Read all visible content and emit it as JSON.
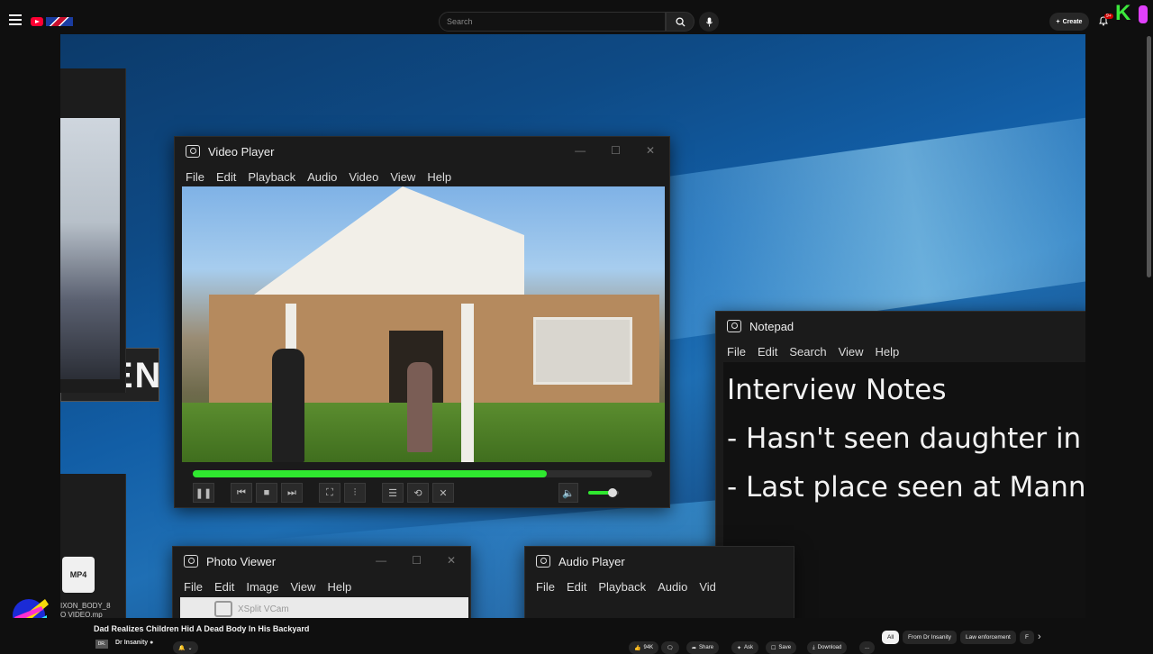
{
  "header": {
    "search_placeholder": "Search",
    "create_label": "Create",
    "notif_badge": "9+",
    "avatar_letter": "K"
  },
  "video_player": {
    "title": "Video Player",
    "menu": [
      "File",
      "Edit",
      "Playback",
      "Audio",
      "Video",
      "View",
      "Help"
    ],
    "progress": 0.77,
    "volume": 0.8
  },
  "left_window": {
    "name_fragment": "LLEN",
    "file_icon": "MP4",
    "file_name_lines": [
      "IXON_BODY_8",
      "O VIDEO.mp"
    ]
  },
  "notepad": {
    "title": "Notepad",
    "menu": [
      "File",
      "Edit",
      "Search",
      "View",
      "Help"
    ],
    "lines": [
      "Interview Notes",
      "- Hasn't seen daughter in m",
      "- Last place seen at Manny'"
    ]
  },
  "photo_viewer": {
    "title": "Photo Viewer",
    "menu": [
      "File",
      "Edit",
      "Image",
      "View",
      "Help"
    ],
    "watermark": "XSplit VCam"
  },
  "audio_player": {
    "title": "Audio Player",
    "menu": [
      "File",
      "Edit",
      "Playback",
      "Audio",
      "Vid"
    ]
  },
  "bottom": {
    "video_title": "Dad Realizes Children Hid A Dead Body In His Backyard",
    "channel_name": "Dr Insanity",
    "channel_avatar_text": "DR.",
    "actions": {
      "likes": "94K",
      "share": "Share",
      "ask": "Ask",
      "save": "Save",
      "download": "Download",
      "more": "..."
    },
    "chips": [
      "All",
      "From Dr Insanity",
      "Law enforcement",
      "F"
    ]
  }
}
